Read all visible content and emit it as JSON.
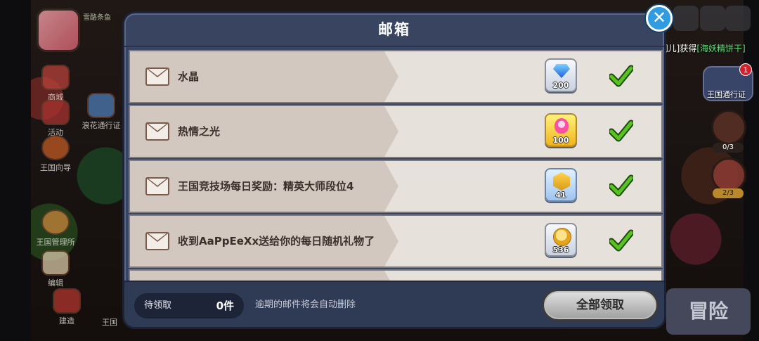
{
  "dialog": {
    "title": "邮箱",
    "close_symbol": "✕"
  },
  "mails": [
    {
      "title": "水晶",
      "reward_icon": "crystal-icon",
      "reward_amount": "200",
      "claimed": true
    },
    {
      "title": "热情之光",
      "reward_icon": "pink-gem-icon",
      "reward_amount": "100",
      "claimed": true
    },
    {
      "title": "王国竞技场每日奖励：精英大师段位4",
      "reward_icon": "medal-icon",
      "reward_amount": "41",
      "claimed": true
    },
    {
      "title": "收到AaPpEeXx送给你的每日随机礼物了",
      "reward_icon": "coin-icon",
      "reward_amount": "536",
      "claimed": true
    }
  ],
  "footer": {
    "pending_label": "待领取",
    "pending_value": "0件",
    "notice": "逾期的邮件将会自动删除",
    "claim_all_label": "全部领取"
  },
  "game_bg": {
    "left_menu": [
      "商城",
      "活动",
      "王国向导",
      "浪花通行证",
      "王国管理所",
      "编辑",
      "建造",
      "王国"
    ],
    "right_notice_prefix": "[澜儿]获得",
    "right_notice_item": "[海妖精饼干]",
    "kingdom_pass_label": "王国通行证",
    "kingdom_pass_badge": "1",
    "counter_1": "0/3",
    "counter_2": "2/3",
    "adventure_label": "冒险",
    "avatar_status": "雪酪条鱼"
  },
  "colors": {
    "dialog_bg": "#384460",
    "row_bg": "#e7e1db",
    "check_green": "#58c320",
    "close_blue": "#2f9be0"
  }
}
